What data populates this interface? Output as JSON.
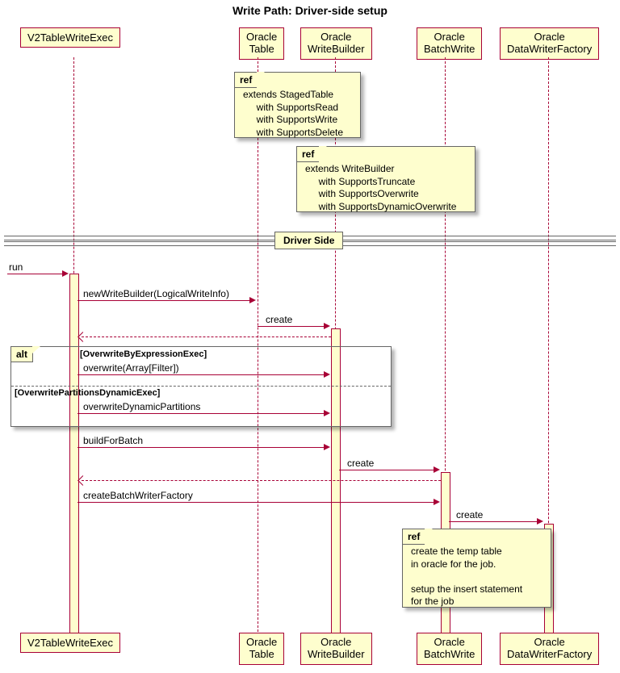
{
  "title": "Write Path: Driver-side setup",
  "participants": {
    "p1": "V2TableWriteExec",
    "p2_l1": "Oracle",
    "p2_l2": "Table",
    "p3_l1": "Oracle",
    "p3_l2": "WriteBuilder",
    "p4_l1": "Oracle",
    "p4_l2": "BatchWrite",
    "p5_l1": "Oracle",
    "p5_l2": "DataWriterFactory"
  },
  "ref1": "extends StagedTable\n     with SupportsRead\n     with SupportsWrite\n     with SupportsDelete",
  "ref2": "extends WriteBuilder\n     with SupportsTruncate\n     with SupportsOverwrite\n     with SupportsDynamicOverwrite",
  "ref3": "create the temp table\nin oracle for the job.\n\nsetup the insert statement\nfor the job",
  "divider": "Driver Side",
  "msg": {
    "run": "run",
    "newWB": "newWriteBuilder(LogicalWriteInfo)",
    "create1": "create",
    "overwrite": "overwrite(Array[Filter])",
    "overwriteDyn": "overwriteDynamicPartitions",
    "buildBatch": "buildForBatch",
    "create2": "create",
    "createBWF": "createBatchWriterFactory",
    "create3": "create"
  },
  "alt": {
    "label": "alt",
    "guard1": "[OverwriteByExpressionExec]",
    "guard2": "[OverwritePartitionsDynamicExec]"
  },
  "refLabel": "ref"
}
